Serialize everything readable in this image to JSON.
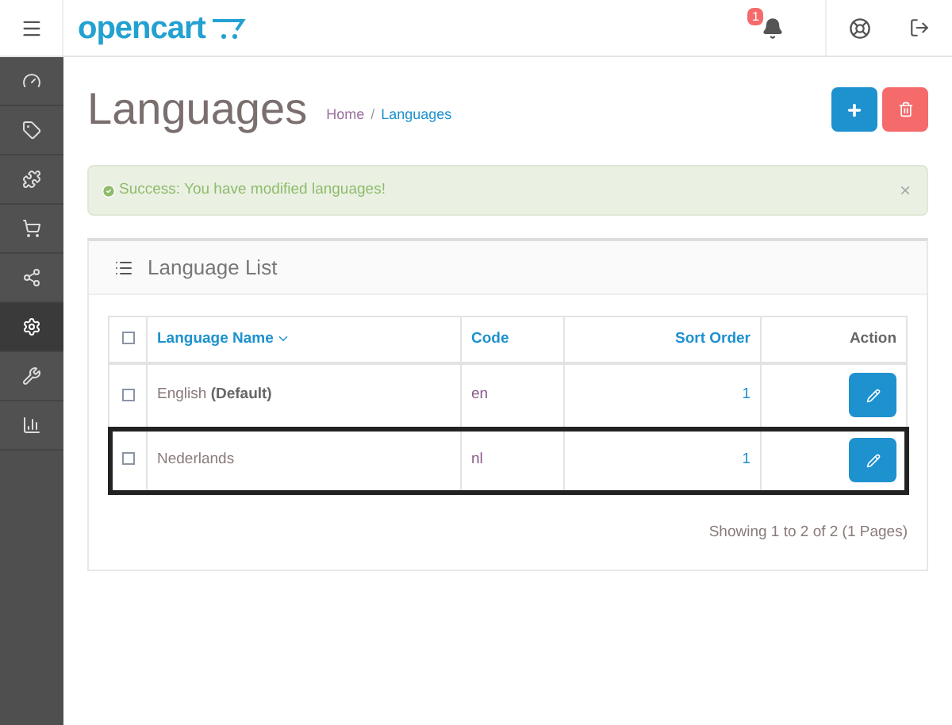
{
  "header": {
    "logo": "opencart",
    "notification_count": "1"
  },
  "sidebar": {
    "items": [
      {
        "selected": false
      },
      {
        "selected": false
      },
      {
        "selected": false
      },
      {
        "selected": false
      },
      {
        "selected": false
      },
      {
        "selected": true
      },
      {
        "selected": false
      },
      {
        "selected": false
      }
    ]
  },
  "page": {
    "title": "Languages",
    "breadcrumb": [
      {
        "label": "Home",
        "selected": false
      },
      {
        "separator": "/",
        "label": "Languages",
        "selected": true
      }
    ]
  },
  "alert": {
    "message": "Success: You have modified languages!",
    "close": "×"
  },
  "panel": {
    "title": "Language List",
    "table": {
      "select_all_checked": false,
      "columns": [
        {
          "label": "Language Name",
          "sort_caret": true,
          "kind": "link"
        },
        {
          "label": "Code",
          "sort_caret": false,
          "kind": "link"
        },
        {
          "label": "Sort Order",
          "sort_caret": false,
          "kind": "link"
        },
        {
          "label": "Action",
          "sort_caret": false,
          "kind": "plain"
        }
      ],
      "rows": [
        {
          "name": "English",
          "suffix": "(Default)",
          "code": "en",
          "sort_order": "1",
          "checked": false,
          "highlighted": false
        },
        {
          "name": "Nederlands",
          "code": "nl",
          "sort_order": "1",
          "checked": false,
          "highlighted": true
        }
      ]
    },
    "pagination": "Showing 1 to 2 of 2 (1 Pages)"
  }
}
